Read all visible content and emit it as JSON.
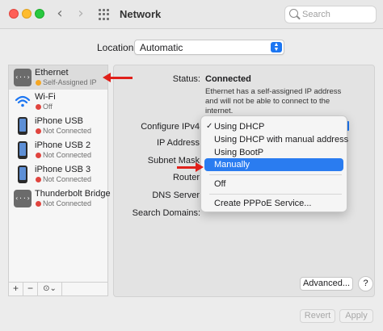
{
  "window": {
    "title": "Network"
  },
  "search": {
    "placeholder": "Search"
  },
  "location": {
    "label": "Location:",
    "value": "Automatic"
  },
  "services": [
    {
      "name": "Ethernet",
      "status": "Self-Assigned IP",
      "dot_color": "#f5a623",
      "icon": "ethernet-icon"
    },
    {
      "name": "Wi-Fi",
      "status": "Off",
      "dot_color": "#e0443e",
      "icon": "wifi-icon"
    },
    {
      "name": "iPhone USB",
      "status": "Not Connected",
      "dot_color": "#e0443e",
      "icon": "iphone-icon"
    },
    {
      "name": "iPhone USB 2",
      "status": "Not Connected",
      "dot_color": "#e0443e",
      "icon": "iphone-icon"
    },
    {
      "name": "iPhone USB 3",
      "status": "Not Connected",
      "dot_color": "#e0443e",
      "icon": "iphone-icon"
    },
    {
      "name": "Thunderbolt Bridge",
      "status": "Not Connected",
      "dot_color": "#e0443e",
      "icon": "ethernet-icon"
    }
  ],
  "sidebar_footer": {
    "add": "+",
    "remove": "−",
    "more": "⊙⌄"
  },
  "detail": {
    "status_label": "Status:",
    "status_value": "Connected",
    "status_description": "Ethernet has a self-assigned IP address and will not be able to connect to the internet.",
    "configure_label": "Configure IPv4",
    "ip_label": "IP Address",
    "subnet_label": "Subnet Mask",
    "router_label": "Router",
    "dns_label": "DNS Server",
    "search_domains_label": "Search Domains:"
  },
  "menu": {
    "items": [
      "Using DHCP",
      "Using DHCP with manual address",
      "Using BootP",
      "Manually",
      "Off",
      "Create PPPoE Service..."
    ],
    "checked": "Using DHCP",
    "highlighted": "Manually",
    "check_glyph": "✓"
  },
  "buttons": {
    "advanced": "Advanced...",
    "help": "?",
    "revert": "Revert",
    "apply": "Apply"
  },
  "accent": "#2a7cf0",
  "annotation_color": "#e0201a"
}
